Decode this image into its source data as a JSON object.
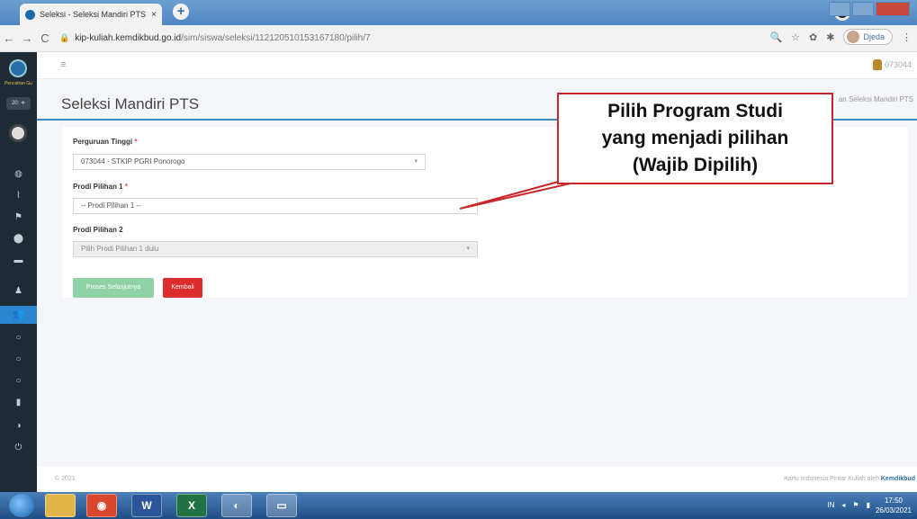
{
  "browser": {
    "tab_title": "Seleksi - Seleksi Mandiri PTS • KI",
    "tab_close": "×",
    "new_tab": "+",
    "url_host": "kip-kuliah.kemdikbud.go.id",
    "url_path": "/sim/siswa/seleksi/112120510153167180/pilih/7",
    "profile_name": "Djeda"
  },
  "sidebar": {
    "brand_text": "Pencatran Gu",
    "year_select": "20: ≑",
    "items": [
      "◍",
      "⌇",
      "⚑",
      "⬤",
      "▬",
      "♟",
      "👥",
      "○",
      "○",
      "○",
      "▮",
      "◑",
      "⏻"
    ]
  },
  "apptop": {
    "menu_glyph": "≡",
    "user_id": "073044"
  },
  "page": {
    "title": "Seleksi Mandiri PTS",
    "breadcrumb": "an Seleksi Mandiri PTS"
  },
  "form": {
    "pt_label": "Perguruan Tinggi",
    "pt_value": "073044 - STKIP PGRI Ponorogo",
    "prodi1_label": "Prodi Pilihan 1",
    "prodi1_placeholder": "-- Prodi Pilihan 1 --",
    "prodi2_label": "Prodi Pilihan 2",
    "prodi2_placeholder": "Pilih Prodi Pilihan 1 dulu",
    "required_mark": "*",
    "next_button": "Proses Selanjutnya",
    "back_button": "Kembali"
  },
  "callout": {
    "line1": "Pilih Program Studi",
    "line2": "yang menjadi pilihan",
    "line3": "(Wajib Dipilih)"
  },
  "footer": {
    "copyright": "© 2021",
    "credit_prefix": "Kartu Indonesia Pintar Kuliah oleh",
    "credit_brand": "Kemdikbud"
  },
  "taskbar": {
    "apps": [
      "",
      "◉",
      "W",
      "X",
      "◐",
      "▭"
    ],
    "lang": "IN",
    "time": "17:50",
    "date": "26/03/2021"
  },
  "colors": {
    "accent": "#3c8dbc",
    "sidebar_bg": "#1e2a35",
    "callout_border": "#c8262a",
    "next_button": "#8fd2a6",
    "back_button": "#dd2c2c"
  }
}
